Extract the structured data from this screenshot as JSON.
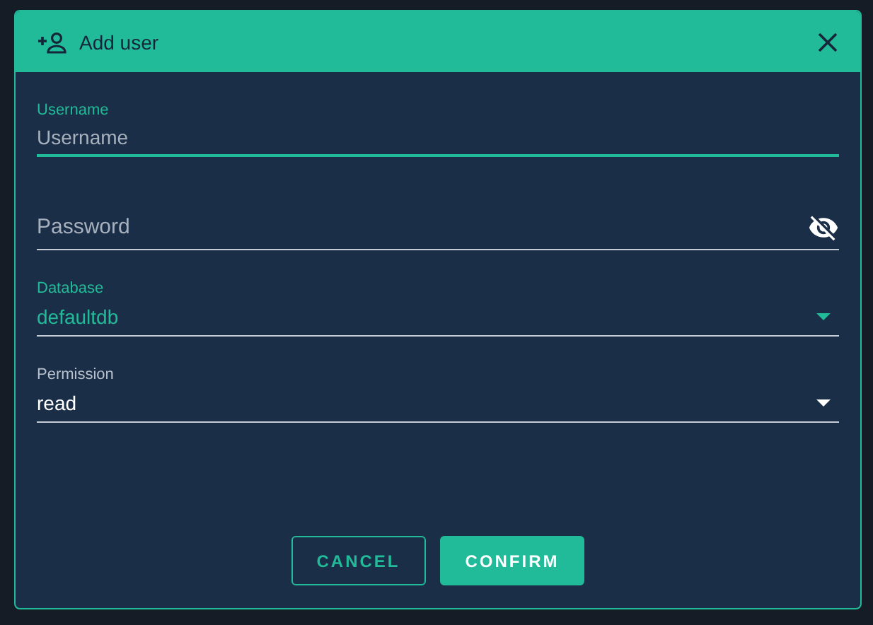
{
  "dialog": {
    "title": "Add user"
  },
  "fields": [
    {
      "kind": "text",
      "label": "Username",
      "placeholder": "Username",
      "focused": true
    },
    {
      "kind": "password",
      "placeholder": "Password",
      "focused": false
    },
    {
      "kind": "select",
      "label": "Database",
      "value": "defaultdb",
      "focused": true
    },
    {
      "kind": "select",
      "label": "Permission",
      "value": "read",
      "focused": false
    }
  ],
  "buttons": [
    {
      "label": "CANCEL",
      "kind": "outlined"
    },
    {
      "label": "CONFIRM",
      "kind": "filled"
    }
  ]
}
